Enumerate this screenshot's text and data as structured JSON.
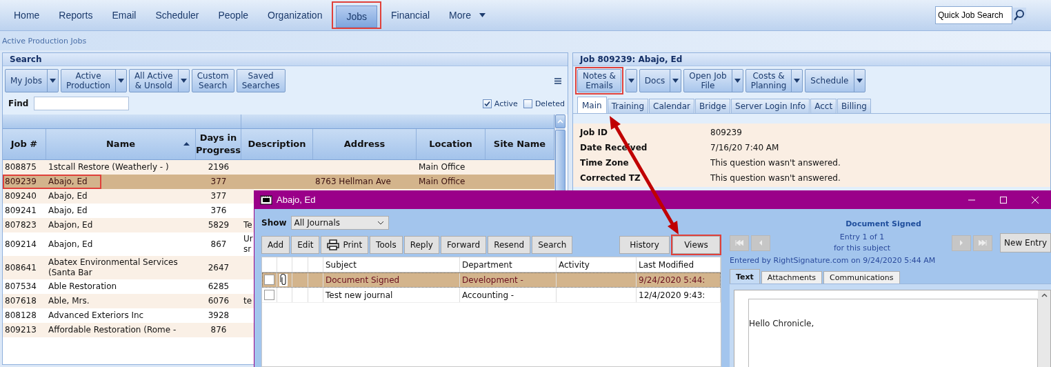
{
  "nav": {
    "items": [
      {
        "label": "Home",
        "selected": false,
        "highlighted": false
      },
      {
        "label": "Reports",
        "selected": false,
        "highlighted": false
      },
      {
        "label": "Email",
        "selected": false,
        "highlighted": false
      },
      {
        "label": "Scheduler",
        "selected": false,
        "highlighted": false
      },
      {
        "label": "People",
        "selected": false,
        "highlighted": false
      },
      {
        "label": "Organization",
        "selected": false,
        "highlighted": false
      },
      {
        "label": "Jobs",
        "selected": true,
        "highlighted": true
      },
      {
        "label": "Financial",
        "selected": false,
        "highlighted": false
      },
      {
        "label": "More",
        "selected": false,
        "highlighted": false,
        "dropdown": true
      }
    ],
    "quick_search": {
      "placeholder": "Quick Job Search"
    }
  },
  "breadcrumb": "Active Production Jobs",
  "search_panel": {
    "title": "Search",
    "buttons": [
      {
        "label": "My Jobs",
        "dropdown": true
      },
      {
        "label": "Active\nProduction",
        "dropdown": true
      },
      {
        "label": "All Active\n& Unsold",
        "dropdown": true
      },
      {
        "label": "Custom\nSearch",
        "dropdown": false
      },
      {
        "label": "Saved\nSearches",
        "dropdown": false
      }
    ],
    "find_label": "Find",
    "filters": [
      {
        "label": "Active",
        "checked": true
      },
      {
        "label": "Deleted",
        "checked": false
      }
    ]
  },
  "jobs": {
    "columns": [
      {
        "label": "Job #"
      },
      {
        "label": "Name",
        "sorted": true
      },
      {
        "label": "Days in\nProgress"
      },
      {
        "label": "Description"
      },
      {
        "label": "Address"
      },
      {
        "label": "Location"
      },
      {
        "label": "Site Name"
      }
    ],
    "rows": [
      {
        "job": "808875",
        "name": "1stcall Restore (Weatherly - )",
        "days": "2196",
        "location": "Main Office",
        "selected": false,
        "highlighted": false
      },
      {
        "job": "809239",
        "name": "Abajo, Ed",
        "days": "377",
        "address": "8763 Hellman Ave",
        "location": "Main Office",
        "selected": true,
        "highlighted": true
      },
      {
        "job": "809240",
        "name": "Abajo, Ed",
        "days": "377",
        "selected": false,
        "highlighted": false
      },
      {
        "job": "809241",
        "name": "Abajo, Ed",
        "days": "376",
        "selected": false,
        "highlighted": false
      },
      {
        "job": "807823",
        "name": "Abajon, Ed",
        "days": "5829",
        "description": "Te",
        "selected": false,
        "highlighted": false
      },
      {
        "job": "809214",
        "name": "Abajon, Ed",
        "days": "867",
        "description": "Ur sr",
        "selected": false,
        "highlighted": false
      },
      {
        "job": "808641",
        "name": "Abatex Environmental Services (Santa Bar",
        "days": "2647",
        "selected": false,
        "highlighted": false
      },
      {
        "job": "807534",
        "name": "Able Restoration",
        "days": "6285",
        "selected": false,
        "highlighted": false
      },
      {
        "job": "807618",
        "name": "Able, Mrs.",
        "days": "6076",
        "description": "te",
        "selected": false,
        "highlighted": false
      },
      {
        "job": "808128",
        "name": "Advanced Exteriors Inc",
        "days": "3928",
        "selected": false,
        "highlighted": false
      },
      {
        "job": "809213",
        "name": "Affordable Restoration (Rome -",
        "days": "876",
        "selected": false,
        "highlighted": false
      }
    ]
  },
  "job_panel": {
    "title": "Job 809239: Abajo, Ed",
    "buttons": [
      {
        "label": "Notes &\nEmails",
        "highlighted": true
      },
      {
        "label": "Docs",
        "highlighted": false
      },
      {
        "label": "Open Job\nFile",
        "highlighted": false
      },
      {
        "label": "Costs &\nPlanning",
        "highlighted": false
      },
      {
        "label": "Schedule",
        "highlighted": false
      }
    ],
    "tabs": [
      {
        "label": "Main",
        "selected": true
      },
      {
        "label": "Training",
        "selected": false
      },
      {
        "label": "Calendar",
        "selected": false
      },
      {
        "label": "Bridge",
        "selected": false
      },
      {
        "label": "Server Login Info",
        "selected": false
      },
      {
        "label": "Acct",
        "selected": false
      },
      {
        "label": "Billing",
        "selected": false
      }
    ],
    "fields": [
      {
        "label": "Job ID",
        "value": "809239"
      },
      {
        "label": "Date Received",
        "value": "7/16/20 7:40 AM"
      },
      {
        "label": "Time Zone",
        "value": "This question wasn't answered."
      },
      {
        "label": "Corrected TZ",
        "value": "This question wasn't answered."
      }
    ]
  },
  "journal_window": {
    "title": "Abajo, Ed",
    "show": {
      "label": "Show",
      "value": "All Journals"
    },
    "buttons": [
      {
        "label": "Add",
        "icon": false
      },
      {
        "label": "Edit",
        "icon": false
      },
      {
        "label": "Print",
        "icon": true
      },
      {
        "label": "Tools",
        "icon": false
      },
      {
        "label": "Reply",
        "icon": false
      },
      {
        "label": "Forward",
        "icon": false
      },
      {
        "label": "Resend",
        "icon": false
      },
      {
        "label": "Search",
        "icon": false
      }
    ],
    "view_buttons": [
      {
        "label": "History",
        "highlighted": false
      },
      {
        "label": "Views",
        "highlighted": true
      }
    ],
    "columns": [
      "Subject",
      "Department",
      "Activity",
      "Last Modified"
    ],
    "rows": [
      {
        "checked": false,
        "attachment": true,
        "subject": "Document Signed",
        "department": "Development -",
        "last_modified": "9/24/2020 5:44:",
        "selected": true
      },
      {
        "checked": false,
        "attachment": false,
        "subject": "Test new journal",
        "department": "Accounting -",
        "last_modified": "12/4/2020 9:43:",
        "selected": false
      }
    ],
    "entry": {
      "subject": "Document Signed",
      "counter": "Entry 1 of 1\nfor this subject",
      "new_entry": "New Entry",
      "entered_by": "Entered by RightSignature.com on 9/24/2020 5:44 AM",
      "tabs": [
        {
          "label": "Text",
          "selected": true
        },
        {
          "label": "Attachments",
          "selected": false
        },
        {
          "label": "Communications",
          "selected": false
        }
      ],
      "body": "Hello Chronicle,"
    }
  }
}
